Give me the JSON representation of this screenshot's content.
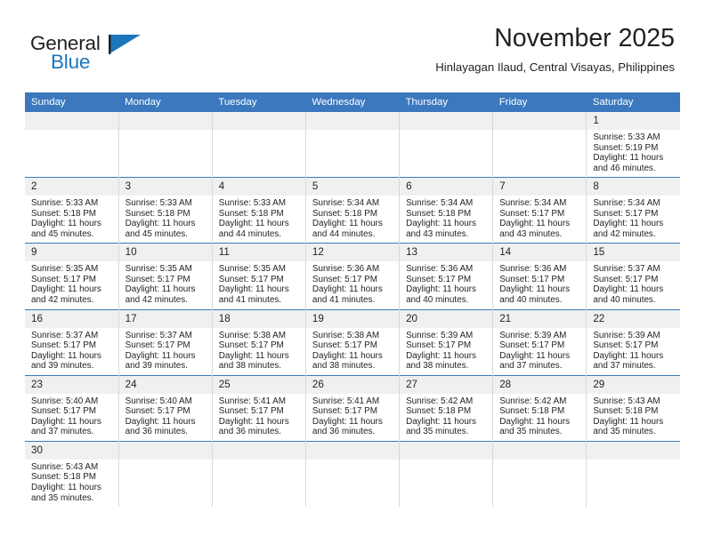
{
  "brand": {
    "name_top": "General",
    "name_bottom": "Blue",
    "flag_icon": "blue-triangle-flag-icon",
    "color_top": "#231f20",
    "color_bottom": "#1c76bc"
  },
  "header": {
    "title": "November 2025",
    "subtitle": "Hinlayagan Ilaud, Central Visayas, Philippines"
  },
  "theme": {
    "header_blue": "#3b78be",
    "daynum_grey": "#f0f0f0",
    "text": "#231f20"
  },
  "calendar": {
    "weekday_headers": [
      "Sunday",
      "Monday",
      "Tuesday",
      "Wednesday",
      "Thursday",
      "Friday",
      "Saturday"
    ],
    "weeks": [
      [
        {
          "day": "",
          "empty": true
        },
        {
          "day": "",
          "empty": true
        },
        {
          "day": "",
          "empty": true
        },
        {
          "day": "",
          "empty": true
        },
        {
          "day": "",
          "empty": true
        },
        {
          "day": "",
          "empty": true
        },
        {
          "day": "1",
          "sunrise": "Sunrise: 5:33 AM",
          "sunset": "Sunset: 5:19 PM",
          "daylight_1": "Daylight: 11 hours",
          "daylight_2": "and 46 minutes."
        }
      ],
      [
        {
          "day": "2",
          "sunrise": "Sunrise: 5:33 AM",
          "sunset": "Sunset: 5:18 PM",
          "daylight_1": "Daylight: 11 hours",
          "daylight_2": "and 45 minutes."
        },
        {
          "day": "3",
          "sunrise": "Sunrise: 5:33 AM",
          "sunset": "Sunset: 5:18 PM",
          "daylight_1": "Daylight: 11 hours",
          "daylight_2": "and 45 minutes."
        },
        {
          "day": "4",
          "sunrise": "Sunrise: 5:33 AM",
          "sunset": "Sunset: 5:18 PM",
          "daylight_1": "Daylight: 11 hours",
          "daylight_2": "and 44 minutes."
        },
        {
          "day": "5",
          "sunrise": "Sunrise: 5:34 AM",
          "sunset": "Sunset: 5:18 PM",
          "daylight_1": "Daylight: 11 hours",
          "daylight_2": "and 44 minutes."
        },
        {
          "day": "6",
          "sunrise": "Sunrise: 5:34 AM",
          "sunset": "Sunset: 5:18 PM",
          "daylight_1": "Daylight: 11 hours",
          "daylight_2": "and 43 minutes."
        },
        {
          "day": "7",
          "sunrise": "Sunrise: 5:34 AM",
          "sunset": "Sunset: 5:17 PM",
          "daylight_1": "Daylight: 11 hours",
          "daylight_2": "and 43 minutes."
        },
        {
          "day": "8",
          "sunrise": "Sunrise: 5:34 AM",
          "sunset": "Sunset: 5:17 PM",
          "daylight_1": "Daylight: 11 hours",
          "daylight_2": "and 42 minutes."
        }
      ],
      [
        {
          "day": "9",
          "sunrise": "Sunrise: 5:35 AM",
          "sunset": "Sunset: 5:17 PM",
          "daylight_1": "Daylight: 11 hours",
          "daylight_2": "and 42 minutes."
        },
        {
          "day": "10",
          "sunrise": "Sunrise: 5:35 AM",
          "sunset": "Sunset: 5:17 PM",
          "daylight_1": "Daylight: 11 hours",
          "daylight_2": "and 42 minutes."
        },
        {
          "day": "11",
          "sunrise": "Sunrise: 5:35 AM",
          "sunset": "Sunset: 5:17 PM",
          "daylight_1": "Daylight: 11 hours",
          "daylight_2": "and 41 minutes."
        },
        {
          "day": "12",
          "sunrise": "Sunrise: 5:36 AM",
          "sunset": "Sunset: 5:17 PM",
          "daylight_1": "Daylight: 11 hours",
          "daylight_2": "and 41 minutes."
        },
        {
          "day": "13",
          "sunrise": "Sunrise: 5:36 AM",
          "sunset": "Sunset: 5:17 PM",
          "daylight_1": "Daylight: 11 hours",
          "daylight_2": "and 40 minutes."
        },
        {
          "day": "14",
          "sunrise": "Sunrise: 5:36 AM",
          "sunset": "Sunset: 5:17 PM",
          "daylight_1": "Daylight: 11 hours",
          "daylight_2": "and 40 minutes."
        },
        {
          "day": "15",
          "sunrise": "Sunrise: 5:37 AM",
          "sunset": "Sunset: 5:17 PM",
          "daylight_1": "Daylight: 11 hours",
          "daylight_2": "and 40 minutes."
        }
      ],
      [
        {
          "day": "16",
          "sunrise": "Sunrise: 5:37 AM",
          "sunset": "Sunset: 5:17 PM",
          "daylight_1": "Daylight: 11 hours",
          "daylight_2": "and 39 minutes."
        },
        {
          "day": "17",
          "sunrise": "Sunrise: 5:37 AM",
          "sunset": "Sunset: 5:17 PM",
          "daylight_1": "Daylight: 11 hours",
          "daylight_2": "and 39 minutes."
        },
        {
          "day": "18",
          "sunrise": "Sunrise: 5:38 AM",
          "sunset": "Sunset: 5:17 PM",
          "daylight_1": "Daylight: 11 hours",
          "daylight_2": "and 38 minutes."
        },
        {
          "day": "19",
          "sunrise": "Sunrise: 5:38 AM",
          "sunset": "Sunset: 5:17 PM",
          "daylight_1": "Daylight: 11 hours",
          "daylight_2": "and 38 minutes."
        },
        {
          "day": "20",
          "sunrise": "Sunrise: 5:39 AM",
          "sunset": "Sunset: 5:17 PM",
          "daylight_1": "Daylight: 11 hours",
          "daylight_2": "and 38 minutes."
        },
        {
          "day": "21",
          "sunrise": "Sunrise: 5:39 AM",
          "sunset": "Sunset: 5:17 PM",
          "daylight_1": "Daylight: 11 hours",
          "daylight_2": "and 37 minutes."
        },
        {
          "day": "22",
          "sunrise": "Sunrise: 5:39 AM",
          "sunset": "Sunset: 5:17 PM",
          "daylight_1": "Daylight: 11 hours",
          "daylight_2": "and 37 minutes."
        }
      ],
      [
        {
          "day": "23",
          "sunrise": "Sunrise: 5:40 AM",
          "sunset": "Sunset: 5:17 PM",
          "daylight_1": "Daylight: 11 hours",
          "daylight_2": "and 37 minutes."
        },
        {
          "day": "24",
          "sunrise": "Sunrise: 5:40 AM",
          "sunset": "Sunset: 5:17 PM",
          "daylight_1": "Daylight: 11 hours",
          "daylight_2": "and 36 minutes."
        },
        {
          "day": "25",
          "sunrise": "Sunrise: 5:41 AM",
          "sunset": "Sunset: 5:17 PM",
          "daylight_1": "Daylight: 11 hours",
          "daylight_2": "and 36 minutes."
        },
        {
          "day": "26",
          "sunrise": "Sunrise: 5:41 AM",
          "sunset": "Sunset: 5:17 PM",
          "daylight_1": "Daylight: 11 hours",
          "daylight_2": "and 36 minutes."
        },
        {
          "day": "27",
          "sunrise": "Sunrise: 5:42 AM",
          "sunset": "Sunset: 5:18 PM",
          "daylight_1": "Daylight: 11 hours",
          "daylight_2": "and 35 minutes."
        },
        {
          "day": "28",
          "sunrise": "Sunrise: 5:42 AM",
          "sunset": "Sunset: 5:18 PM",
          "daylight_1": "Daylight: 11 hours",
          "daylight_2": "and 35 minutes."
        },
        {
          "day": "29",
          "sunrise": "Sunrise: 5:43 AM",
          "sunset": "Sunset: 5:18 PM",
          "daylight_1": "Daylight: 11 hours",
          "daylight_2": "and 35 minutes."
        }
      ],
      [
        {
          "day": "30",
          "sunrise": "Sunrise: 5:43 AM",
          "sunset": "Sunset: 5:18 PM",
          "daylight_1": "Daylight: 11 hours",
          "daylight_2": "and 35 minutes."
        },
        {
          "day": "",
          "empty": true
        },
        {
          "day": "",
          "empty": true
        },
        {
          "day": "",
          "empty": true
        },
        {
          "day": "",
          "empty": true
        },
        {
          "day": "",
          "empty": true
        },
        {
          "day": "",
          "empty": true
        }
      ]
    ]
  }
}
